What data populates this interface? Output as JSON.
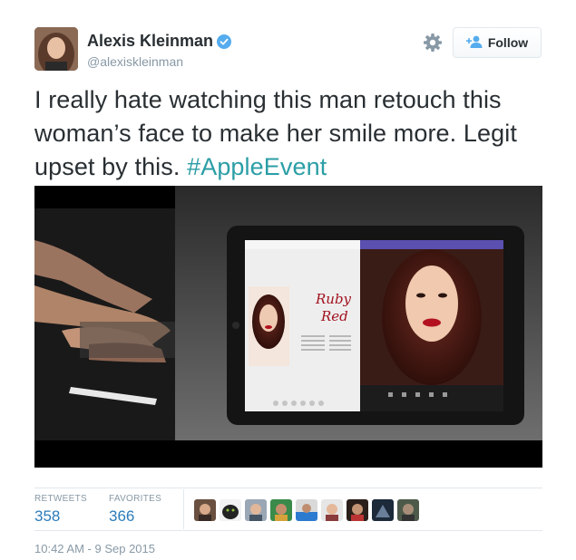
{
  "user": {
    "full_name": "Alexis Kleinman",
    "handle": "@alexiskleinman",
    "verified": true
  },
  "header": {
    "follow_label": "Follow",
    "settings_icon": "gear-icon",
    "follow_icon": "add-person-icon"
  },
  "tweet": {
    "text": "I really hate watching this man retouch this woman’s face to make her smile more. Legit upset by this. ",
    "hashtag": "#AppleEvent"
  },
  "media": {
    "app_page_title": "Ruby Red"
  },
  "stats": {
    "retweets_label": "RETWEETS",
    "retweets_value": "358",
    "favorites_label": "FAVORITES",
    "favorites_value": "366"
  },
  "favoriters_count_shown": 9,
  "timestamp": "10:42 AM - 9 Sep 2015",
  "colors": {
    "hashtag": "#2b9ea6",
    "stat_value": "#2b7bb9",
    "muted": "#8899a6",
    "verified": "#55acee"
  }
}
